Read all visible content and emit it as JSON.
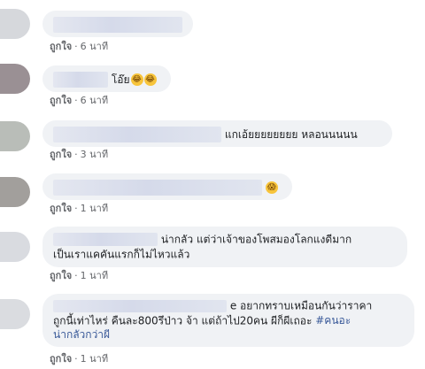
{
  "like_label": "ถูกใจ",
  "separator": "·",
  "comments": [
    {
      "text": "",
      "time": "6 นาที"
    },
    {
      "text": "โอ๊ย",
      "emojis": [
        "😂",
        "😂"
      ],
      "time": "6 นาที"
    },
    {
      "text": "แกเอ้ยยยยยยยย หลอนนนนน",
      "time": "3 นาที"
    },
    {
      "text": "",
      "emojis": [
        "😱"
      ],
      "time": "1 นาที"
    },
    {
      "text_line1": "น่ากลัว แต่ว่าเจ้าของโพสมองโลกแงดีมาก",
      "text_line2": "เป็นเราแคคันแรกก็ไม่ไหวแล้ว",
      "time": "1 นาที"
    },
    {
      "text_line1": "e อยากทราบเหมือนกันว่าราคา",
      "text_line2": "ถูกนี้เท่าไหร่ คืนละ800รึป่าว จ้า แต่ถ้าไป20คน ผีก็ผีเถอะ",
      "hashtag": "#คนอะ",
      "text_line3": "น่ากลัวกว่าผี",
      "time": "1 นาที"
    }
  ],
  "colors": {
    "bubble_bg": "#f0f2f5",
    "meta_text": "#65676b",
    "hashtag": "#385898"
  }
}
